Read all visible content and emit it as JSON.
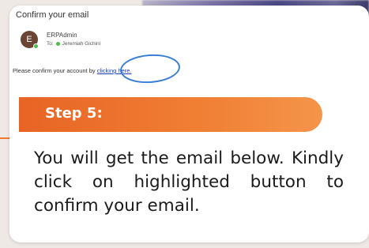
{
  "email": {
    "title": "Confirm your email",
    "avatar_letter": "E",
    "sender": "ERPAdmin",
    "to_label": "To:",
    "recipient": "Jeremiah Gichini",
    "body_text": "Please confirm your account by ",
    "link_text": "clicking here."
  },
  "step": {
    "label": "Step 5:",
    "instruction": "You will get the email below. Kindly click on highlighted button to confirm your email."
  },
  "colors": {
    "accent": "#f07a2e",
    "highlight": "#3b7fd4",
    "link": "#1a3fb8"
  }
}
